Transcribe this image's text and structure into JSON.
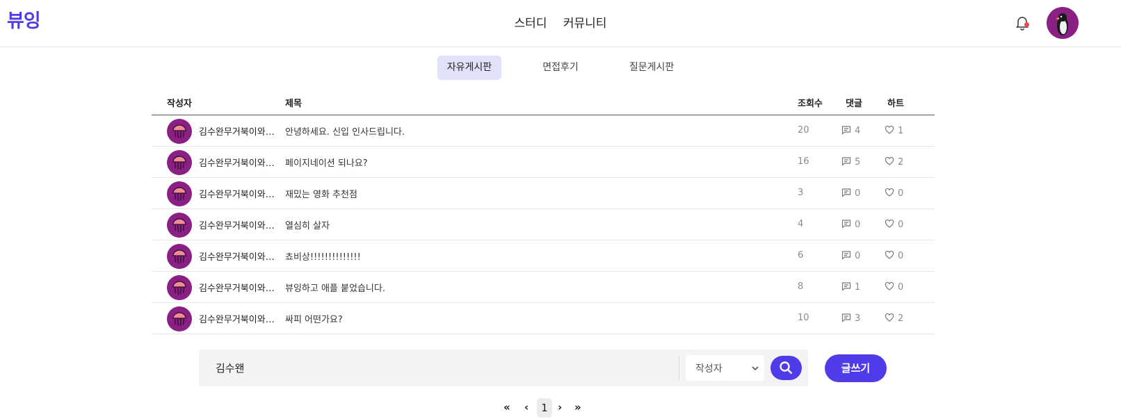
{
  "header": {
    "logo": "뷰잉",
    "nav": [
      "스터디",
      "커뮤니티"
    ],
    "icons": {
      "notification": "bell-icon",
      "profile": "penguin-avatar"
    }
  },
  "tabs": [
    {
      "label": "자유게시판",
      "active": true
    },
    {
      "label": "면접후기",
      "active": false
    },
    {
      "label": "질문게시판",
      "active": false
    }
  ],
  "table": {
    "columns": [
      "작성자",
      "제목",
      "조회수",
      "댓글",
      "하트"
    ],
    "rows": [
      {
        "author": "김수완무거북이와두루미",
        "title": "안녕하세요. 신입 인사드립니다.",
        "views": "20",
        "comments": "4",
        "hearts": "1"
      },
      {
        "author": "김수완무거북이와두루미",
        "title": "페이지네이션 되나요?",
        "views": "16",
        "comments": "5",
        "hearts": "2"
      },
      {
        "author": "김수완무거북이와두루미",
        "title": "재밌는 영화 추천점",
        "views": "3",
        "comments": "0",
        "hearts": "0"
      },
      {
        "author": "김수완무거북이와두루미",
        "title": "열심히 살자",
        "views": "4",
        "comments": "0",
        "hearts": "0"
      },
      {
        "author": "김수완무거북이와두루미",
        "title": "쵸비상!!!!!!!!!!!!!!",
        "views": "6",
        "comments": "0",
        "hearts": "0"
      },
      {
        "author": "김수완무거북이와두루미",
        "title": "뷰잉하고 애플 붙었습니다.",
        "views": "8",
        "comments": "1",
        "hearts": "0"
      },
      {
        "author": "김수완무거북이와두루미",
        "title": "싸피 어떤가요?",
        "views": "10",
        "comments": "3",
        "hearts": "2"
      }
    ]
  },
  "search": {
    "value": "김수왠",
    "filter": "작성자",
    "write_label": "글쓰기"
  },
  "pagination": {
    "first": "«",
    "prev": "‹",
    "current": "1",
    "next": "›",
    "last": "»"
  },
  "colors": {
    "accent": "#4f3ce8",
    "avatar_bg": "#8a1f84",
    "tab_active_bg": "#e2e1fb"
  }
}
